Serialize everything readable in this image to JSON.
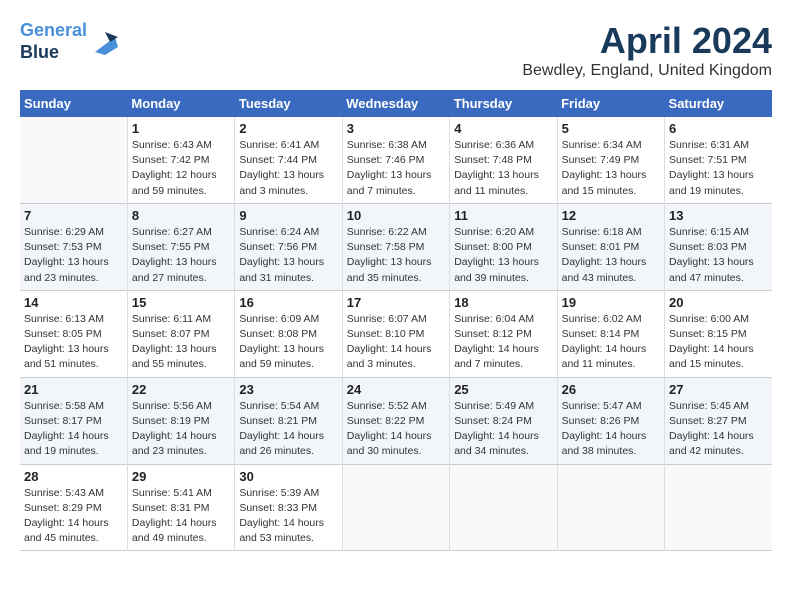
{
  "header": {
    "logo_line1": "General",
    "logo_line2": "Blue",
    "month": "April 2024",
    "location": "Bewdley, England, United Kingdom"
  },
  "weekdays": [
    "Sunday",
    "Monday",
    "Tuesday",
    "Wednesday",
    "Thursday",
    "Friday",
    "Saturday"
  ],
  "weeks": [
    [
      {
        "day": "",
        "empty": true
      },
      {
        "day": "1",
        "sunrise": "6:43 AM",
        "sunset": "7:42 PM",
        "daylight": "12 hours and 59 minutes."
      },
      {
        "day": "2",
        "sunrise": "6:41 AM",
        "sunset": "7:44 PM",
        "daylight": "13 hours and 3 minutes."
      },
      {
        "day": "3",
        "sunrise": "6:38 AM",
        "sunset": "7:46 PM",
        "daylight": "13 hours and 7 minutes."
      },
      {
        "day": "4",
        "sunrise": "6:36 AM",
        "sunset": "7:48 PM",
        "daylight": "13 hours and 11 minutes."
      },
      {
        "day": "5",
        "sunrise": "6:34 AM",
        "sunset": "7:49 PM",
        "daylight": "13 hours and 15 minutes."
      },
      {
        "day": "6",
        "sunrise": "6:31 AM",
        "sunset": "7:51 PM",
        "daylight": "13 hours and 19 minutes."
      }
    ],
    [
      {
        "day": "7",
        "sunrise": "6:29 AM",
        "sunset": "7:53 PM",
        "daylight": "13 hours and 23 minutes."
      },
      {
        "day": "8",
        "sunrise": "6:27 AM",
        "sunset": "7:55 PM",
        "daylight": "13 hours and 27 minutes."
      },
      {
        "day": "9",
        "sunrise": "6:24 AM",
        "sunset": "7:56 PM",
        "daylight": "13 hours and 31 minutes."
      },
      {
        "day": "10",
        "sunrise": "6:22 AM",
        "sunset": "7:58 PM",
        "daylight": "13 hours and 35 minutes."
      },
      {
        "day": "11",
        "sunrise": "6:20 AM",
        "sunset": "8:00 PM",
        "daylight": "13 hours and 39 minutes."
      },
      {
        "day": "12",
        "sunrise": "6:18 AM",
        "sunset": "8:01 PM",
        "daylight": "13 hours and 43 minutes."
      },
      {
        "day": "13",
        "sunrise": "6:15 AM",
        "sunset": "8:03 PM",
        "daylight": "13 hours and 47 minutes."
      }
    ],
    [
      {
        "day": "14",
        "sunrise": "6:13 AM",
        "sunset": "8:05 PM",
        "daylight": "13 hours and 51 minutes."
      },
      {
        "day": "15",
        "sunrise": "6:11 AM",
        "sunset": "8:07 PM",
        "daylight": "13 hours and 55 minutes."
      },
      {
        "day": "16",
        "sunrise": "6:09 AM",
        "sunset": "8:08 PM",
        "daylight": "13 hours and 59 minutes."
      },
      {
        "day": "17",
        "sunrise": "6:07 AM",
        "sunset": "8:10 PM",
        "daylight": "14 hours and 3 minutes."
      },
      {
        "day": "18",
        "sunrise": "6:04 AM",
        "sunset": "8:12 PM",
        "daylight": "14 hours and 7 minutes."
      },
      {
        "day": "19",
        "sunrise": "6:02 AM",
        "sunset": "8:14 PM",
        "daylight": "14 hours and 11 minutes."
      },
      {
        "day": "20",
        "sunrise": "6:00 AM",
        "sunset": "8:15 PM",
        "daylight": "14 hours and 15 minutes."
      }
    ],
    [
      {
        "day": "21",
        "sunrise": "5:58 AM",
        "sunset": "8:17 PM",
        "daylight": "14 hours and 19 minutes."
      },
      {
        "day": "22",
        "sunrise": "5:56 AM",
        "sunset": "8:19 PM",
        "daylight": "14 hours and 23 minutes."
      },
      {
        "day": "23",
        "sunrise": "5:54 AM",
        "sunset": "8:21 PM",
        "daylight": "14 hours and 26 minutes."
      },
      {
        "day": "24",
        "sunrise": "5:52 AM",
        "sunset": "8:22 PM",
        "daylight": "14 hours and 30 minutes."
      },
      {
        "day": "25",
        "sunrise": "5:49 AM",
        "sunset": "8:24 PM",
        "daylight": "14 hours and 34 minutes."
      },
      {
        "day": "26",
        "sunrise": "5:47 AM",
        "sunset": "8:26 PM",
        "daylight": "14 hours and 38 minutes."
      },
      {
        "day": "27",
        "sunrise": "5:45 AM",
        "sunset": "8:27 PM",
        "daylight": "14 hours and 42 minutes."
      }
    ],
    [
      {
        "day": "28",
        "sunrise": "5:43 AM",
        "sunset": "8:29 PM",
        "daylight": "14 hours and 45 minutes."
      },
      {
        "day": "29",
        "sunrise": "5:41 AM",
        "sunset": "8:31 PM",
        "daylight": "14 hours and 49 minutes."
      },
      {
        "day": "30",
        "sunrise": "5:39 AM",
        "sunset": "8:33 PM",
        "daylight": "14 hours and 53 minutes."
      },
      {
        "day": "",
        "empty": true
      },
      {
        "day": "",
        "empty": true
      },
      {
        "day": "",
        "empty": true
      },
      {
        "day": "",
        "empty": true
      }
    ]
  ],
  "labels": {
    "sunrise_label": "Sunrise:",
    "sunset_label": "Sunset:",
    "daylight_label": "Daylight:"
  }
}
